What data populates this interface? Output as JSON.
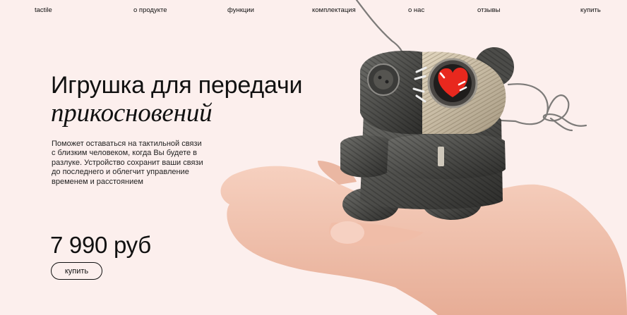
{
  "nav": {
    "logo": "tactile",
    "items": [
      "о продукте",
      "функции",
      "комплектация",
      "о нас",
      "отзывы",
      "купить"
    ]
  },
  "hero": {
    "title_line1": "Игрушка для передачи",
    "title_line2": "прикосновений",
    "description": "Поможет оставаться на тактильной связи с близким человеком, когда Вы будете в разлуке. Устройство сохранит ваши связи до последнего и облегчит управление временем и расстоянием",
    "price": "7 990 руб",
    "buy_label": "купить"
  },
  "colors": {
    "background": "#fcefed",
    "text": "#111111",
    "heart": "#e8281e",
    "skin": "#f2c4b0"
  },
  "icons": [
    "heart-icon"
  ]
}
